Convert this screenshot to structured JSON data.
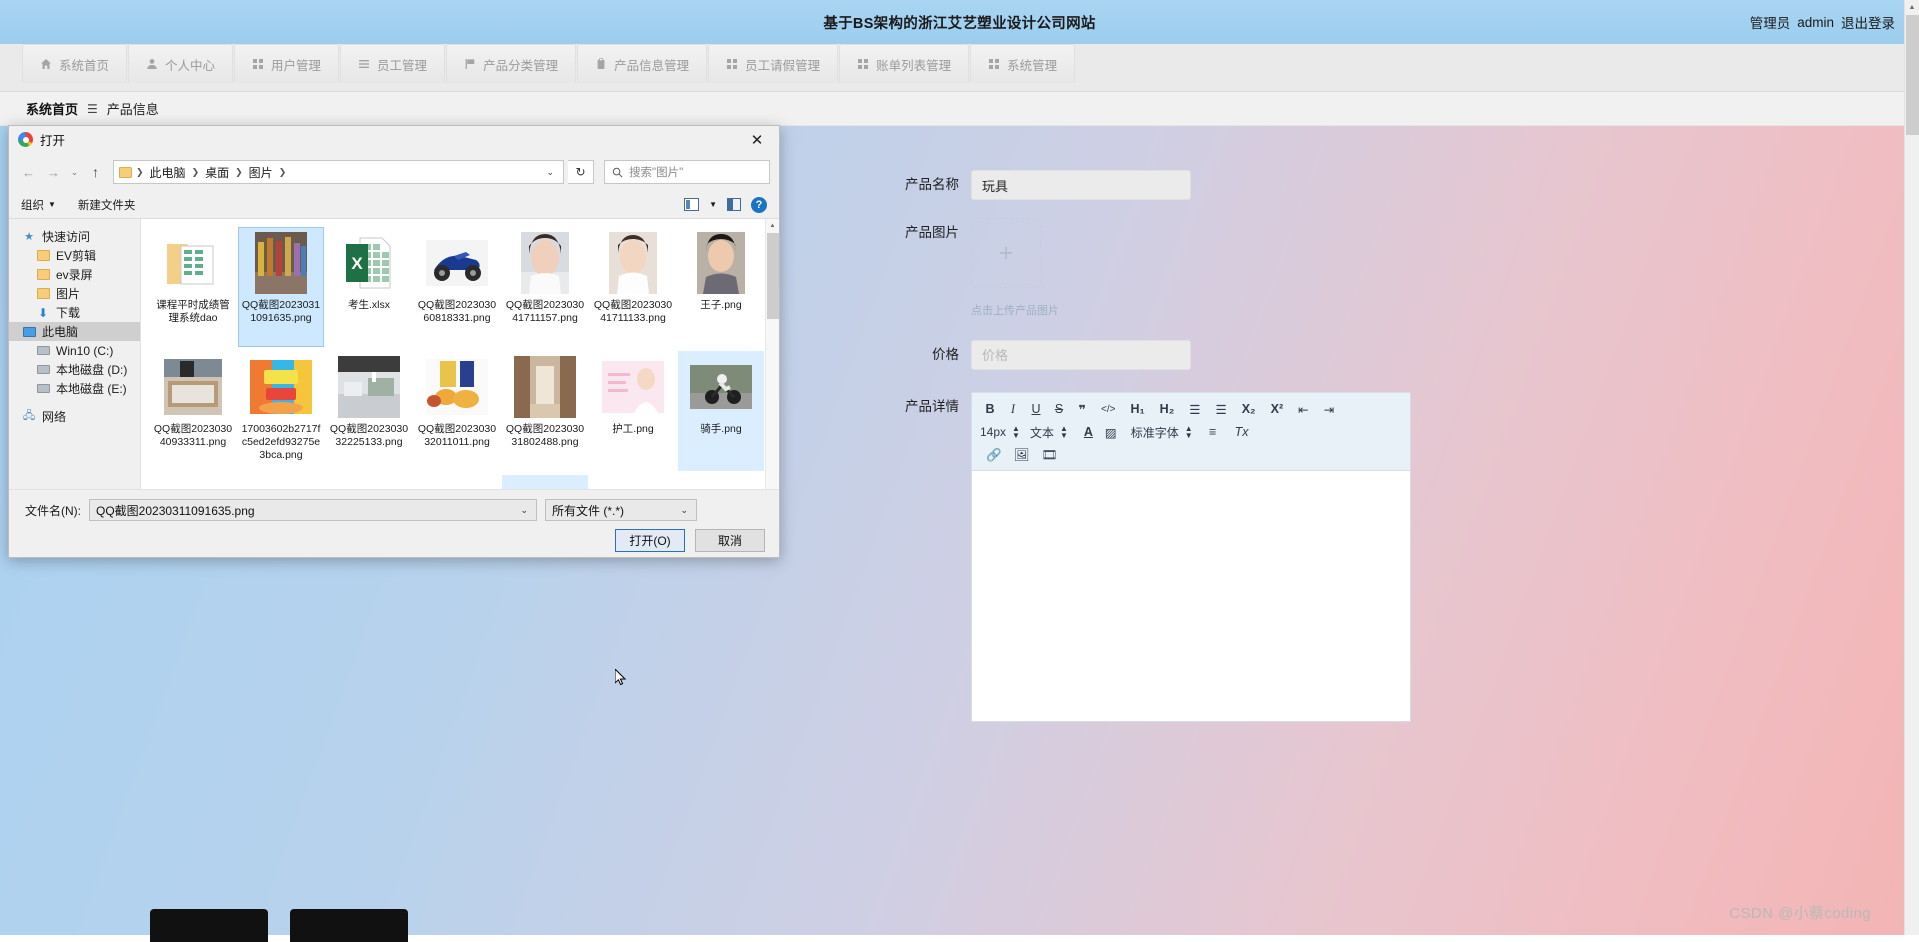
{
  "topbar": {
    "title": "基于BS架构的浙江艾艺塑业设计公司网站",
    "user_role": "管理员",
    "user_name": "admin",
    "logout": "退出登录"
  },
  "nav": {
    "items": [
      {
        "label": "系统首页",
        "icon": "home-icon"
      },
      {
        "label": "个人中心",
        "icon": "user-icon"
      },
      {
        "label": "用户管理",
        "icon": "grid-icon"
      },
      {
        "label": "员工管理",
        "icon": "list-icon"
      },
      {
        "label": "产品分类管理",
        "icon": "flag-icon"
      },
      {
        "label": "产品信息管理",
        "icon": "clipboard-icon"
      },
      {
        "label": "员工请假管理",
        "icon": "grid-icon"
      },
      {
        "label": "账单列表管理",
        "icon": "grid-icon"
      },
      {
        "label": "系统管理",
        "icon": "grid-icon"
      }
    ]
  },
  "breadcrumb": {
    "home": "系统首页",
    "separator": "☰",
    "current": "产品信息"
  },
  "form": {
    "name_label": "产品名称",
    "name_value": "玩具",
    "image_label": "产品图片",
    "upload_plus": "+",
    "upload_tip": "点击上传产品图片",
    "price_label": "价格",
    "price_placeholder": "价格",
    "detail_label": "产品详情"
  },
  "editor": {
    "row1": [
      {
        "name": "bold-icon",
        "glyph": "B"
      },
      {
        "name": "italic-icon",
        "glyph": "I"
      },
      {
        "name": "underline-icon",
        "glyph": "U"
      },
      {
        "name": "strikethrough-icon",
        "glyph": "S"
      },
      {
        "name": "quote-icon",
        "glyph": "❞"
      },
      {
        "name": "code-icon",
        "glyph": "</>"
      },
      {
        "name": "heading1-icon",
        "glyph": "H₁"
      },
      {
        "name": "heading2-icon",
        "glyph": "H₂"
      },
      {
        "name": "ordered-list-icon",
        "glyph": "☰"
      },
      {
        "name": "unordered-list-icon",
        "glyph": "☰"
      },
      {
        "name": "subscript-icon",
        "glyph": "X₂"
      },
      {
        "name": "superscript-icon",
        "glyph": "X²"
      },
      {
        "name": "outdent-icon",
        "glyph": "⇤"
      },
      {
        "name": "indent-icon",
        "glyph": "⇥"
      }
    ],
    "font_size": "14px",
    "text_style": "文本",
    "font_color": "A",
    "bg_color": "▨",
    "font_family": "标准字体",
    "align": "≡",
    "clear_format": "Tx",
    "row3": [
      {
        "name": "link-icon",
        "glyph": "🔗"
      },
      {
        "name": "image-icon",
        "glyph": "🖼"
      },
      {
        "name": "video-icon",
        "glyph": "🎞"
      }
    ]
  },
  "watermark": "CSDN @小蔡coding",
  "dialog": {
    "title": "打开",
    "close": "✕",
    "nav": {
      "back": "←",
      "forward": "→",
      "recent": "⌄",
      "up": "↑",
      "dropdown": "⌄",
      "refresh": "↻"
    },
    "breadcrumbs": [
      "此电脑",
      "桌面",
      "图片"
    ],
    "search_placeholder": "搜索\"图片\"",
    "toolbar": {
      "organize": "组织",
      "new_folder": "新建文件夹"
    },
    "sidebar": [
      {
        "label": "快速访问",
        "icon": "star-icon",
        "indent": false,
        "selected": false
      },
      {
        "label": "EV剪辑",
        "icon": "folder-icon",
        "indent": true,
        "selected": false
      },
      {
        "label": "ev录屏",
        "icon": "folder-icon",
        "indent": true,
        "selected": false
      },
      {
        "label": "图片",
        "icon": "folder-icon",
        "indent": true,
        "selected": false
      },
      {
        "label": "下载",
        "icon": "download-icon",
        "indent": true,
        "selected": false
      },
      {
        "label": "此电脑",
        "icon": "computer-icon",
        "indent": false,
        "selected": true
      },
      {
        "label": "Win10 (C:)",
        "icon": "drive-icon",
        "indent": true,
        "selected": false
      },
      {
        "label": "本地磁盘 (D:)",
        "icon": "drive-icon",
        "indent": true,
        "selected": false
      },
      {
        "label": "本地磁盘 (E:)",
        "icon": "drive-icon",
        "indent": true,
        "selected": false
      },
      {
        "label": "网络",
        "icon": "network-icon",
        "indent": false,
        "selected": false
      }
    ],
    "files": [
      {
        "name": "课程平时成绩管理系统dao",
        "type": "folder",
        "selected": false
      },
      {
        "name": "QQ截图20230311091635.png",
        "type": "image",
        "selected": true,
        "thumb": "figures"
      },
      {
        "name": "考生.xlsx",
        "type": "excel",
        "selected": false
      },
      {
        "name": "QQ截图202303060818331.png",
        "type": "image",
        "selected": false,
        "thumb": "motorcycle"
      },
      {
        "name": "QQ截图202303041711157.png",
        "type": "image",
        "selected": false,
        "thumb": "portrait1"
      },
      {
        "name": "QQ截图202303041711133.png",
        "type": "image",
        "selected": false,
        "thumb": "portrait2"
      },
      {
        "name": "王子.png",
        "type": "image",
        "selected": false,
        "thumb": "portrait3"
      },
      {
        "name": "QQ截图202303040933311.png",
        "type": "image",
        "selected": false,
        "thumb": "hands"
      },
      {
        "name": "17003602b2717fc5ed2efd93275e3bca.png",
        "type": "image",
        "selected": false,
        "thumb": "food-banner"
      },
      {
        "name": "QQ截图202303032225133.png",
        "type": "image",
        "selected": false,
        "thumb": "store"
      },
      {
        "name": "QQ截图202303032011011.png",
        "type": "image",
        "selected": false,
        "thumb": "snacks"
      },
      {
        "name": "QQ截图202303031802488.png",
        "type": "image",
        "selected": false,
        "thumb": "corridor"
      },
      {
        "name": "护工.png",
        "type": "image",
        "selected": false,
        "thumb": "nurse"
      },
      {
        "name": "骑手.png",
        "type": "image",
        "selected": false,
        "thumb": "rider",
        "selected2": true
      }
    ],
    "filename_label": "文件名(N):",
    "filename_value": "QQ截图20230311091635.png",
    "filetype_value": "所有文件 (*.*)",
    "open_button": "打开(O)",
    "cancel_button": "取消"
  }
}
